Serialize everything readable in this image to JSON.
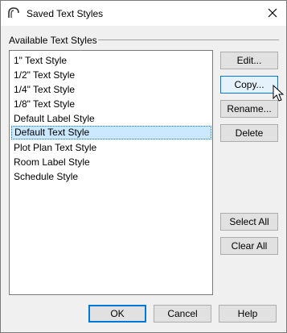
{
  "window": {
    "title": "Saved Text Styles",
    "app_icon": "arch-icon",
    "close_icon": "close-icon"
  },
  "group": {
    "label": "Available Text Styles"
  },
  "styles": {
    "items": [
      "1\" Text Style",
      "1/2\" Text Style",
      "1/4\" Text Style",
      "1/8\" Text Style",
      "Default Label Style",
      "Default Text Style",
      "Plot Plan Text Style",
      "Room Label Style",
      "Schedule Style"
    ],
    "selected": "Default Text Style"
  },
  "buttons": {
    "edit": "Edit...",
    "copy": "Copy...",
    "rename": "Rename...",
    "delete": "Delete",
    "select_all": "Select All",
    "clear_all": "Clear All",
    "ok": "OK",
    "cancel": "Cancel",
    "help": "Help"
  },
  "colors": {
    "selection": "#cce8ff",
    "accent": "#0078d7"
  }
}
